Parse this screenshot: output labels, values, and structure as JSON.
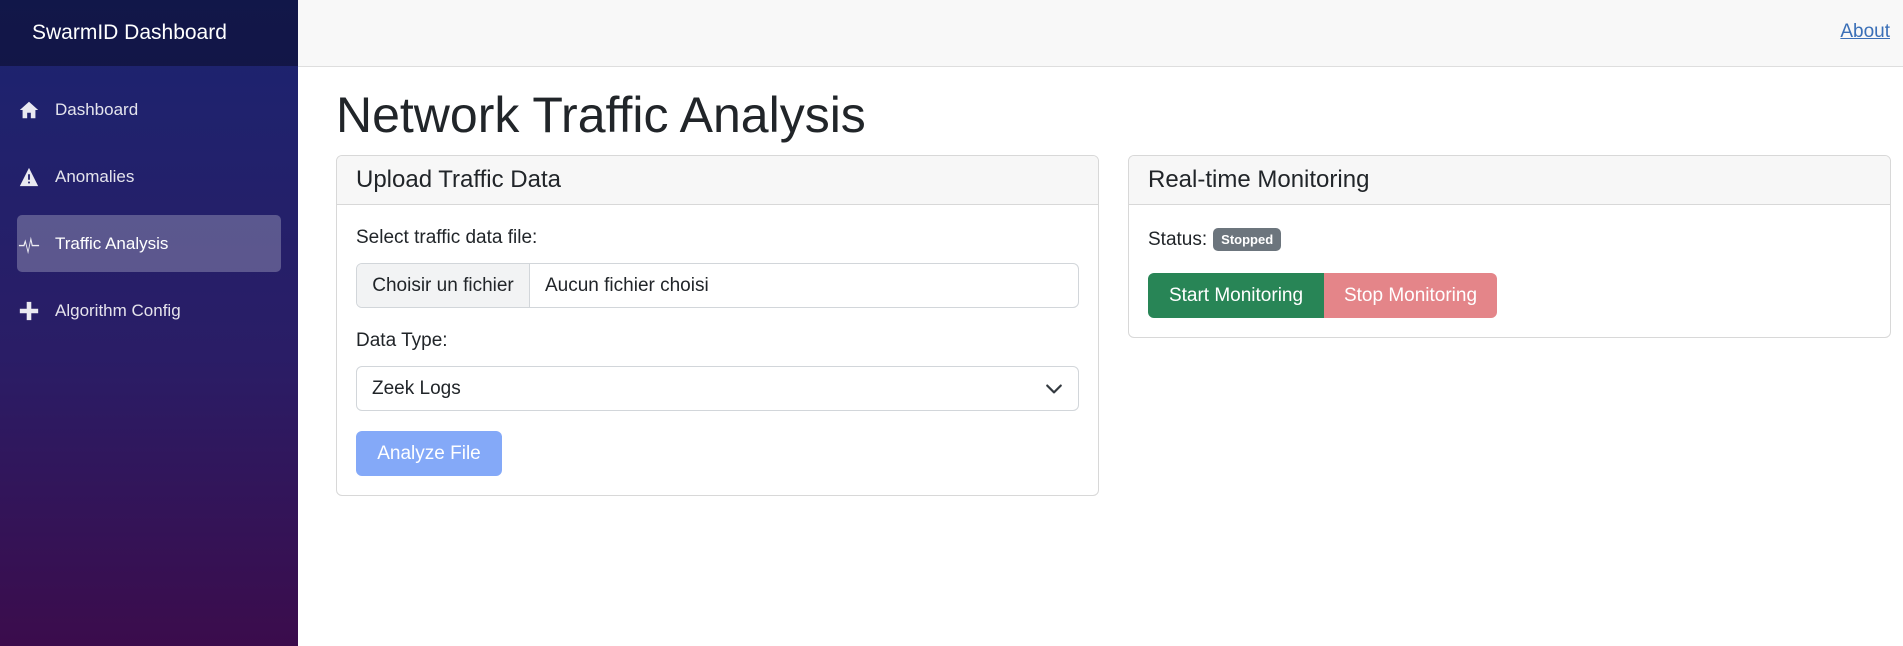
{
  "sidebar": {
    "brand": "SwarmID Dashboard",
    "items": [
      {
        "label": "Dashboard",
        "icon": "home-icon",
        "active": false
      },
      {
        "label": "Anomalies",
        "icon": "warning-icon",
        "active": false
      },
      {
        "label": "Traffic Analysis",
        "icon": "activity-icon",
        "active": true
      },
      {
        "label": "Algorithm Config",
        "icon": "plus-icon",
        "active": false
      }
    ]
  },
  "topbar": {
    "about_label": "About"
  },
  "main": {
    "title": "Network Traffic Analysis",
    "upload": {
      "header": "Upload Traffic Data",
      "file_label": "Select traffic data file:",
      "file_button": "Choisir un fichier",
      "file_name": "Aucun fichier choisi",
      "type_label": "Data Type:",
      "type_value": "Zeek Logs",
      "analyze_label": "Analyze File"
    },
    "monitoring": {
      "header": "Real-time Monitoring",
      "status_label": "Status:",
      "status_value": "Stopped",
      "start_label": "Start Monitoring",
      "stop_label": "Stop Monitoring"
    }
  },
  "colors": {
    "sidebar_top": "#1b2470",
    "sidebar_bottom": "#3b0c4c",
    "success": "#288556",
    "danger_light": "#e48589",
    "primary_light": "#84a9f8",
    "badge": "#6c757d"
  }
}
